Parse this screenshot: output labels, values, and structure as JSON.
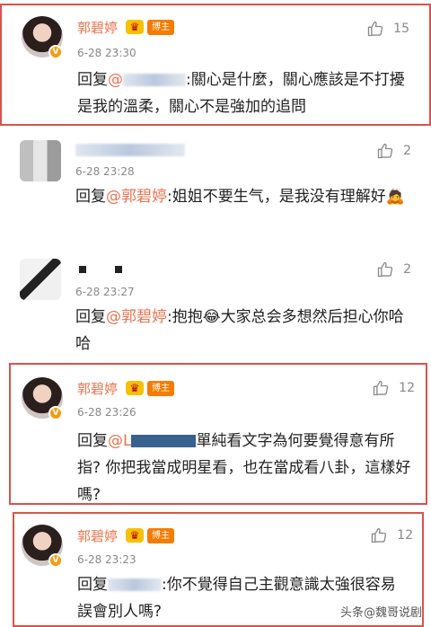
{
  "comments": [
    {
      "name": "郭碧婷",
      "crown_glyph": "♛",
      "badge": "博主",
      "time": "6-28 23:30",
      "likes": "15",
      "reply_prefix": "回复",
      "mention": "@",
      "text": ":關心是什麼，關心應該是不打擾是我的溫柔，關心不是強加的追問"
    },
    {
      "time": "6-28 23:28",
      "likes": "2",
      "reply_prefix": "回复",
      "mention": "@郭碧婷",
      "text": ":姐姐不要生气，是我没有理解好🙇"
    },
    {
      "time": "6-28 23:27",
      "likes": "2",
      "reply_prefix": "回复",
      "mention": "@郭碧婷",
      "text": ":抱抱😂大家总会多想然后担心你哈哈"
    },
    {
      "name": "郭碧婷",
      "crown_glyph": "♛",
      "badge": "博主",
      "time": "6-28 23:26",
      "likes": "12",
      "reply_prefix": "回复",
      "mention": "@L",
      "text": "單純看文字為何要覺得意有所指? 你把我當成明星看，也在當成看八卦，這樣好嗎?"
    },
    {
      "name": "郭碧婷",
      "crown_glyph": "♛",
      "badge": "博主",
      "time": "6-28 23:23",
      "likes": "12",
      "reply_prefix": "回复",
      "mention": "",
      "text": ":你不覺得自己主觀意識太強很容易誤會別人嗎?"
    }
  ],
  "watermark": "头条@魏哥说剧",
  "colors": {
    "accent": "#eb7350",
    "highlight_border": "#d9534f",
    "badge": "#f57c00"
  },
  "icons": [
    "thumb-up-icon",
    "crown-icon",
    "verified-badge-icon"
  ]
}
